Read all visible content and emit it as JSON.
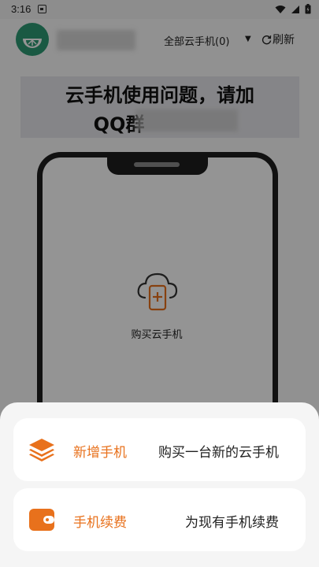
{
  "status_bar": {
    "time": "3:16"
  },
  "header": {
    "device_select": "全部云手机(0)",
    "refresh_label": "刷新"
  },
  "notice": {
    "line1": "云手机使用问题，请加",
    "line2": "QQ群"
  },
  "main": {
    "buy_label": "购买云手机"
  },
  "sheet": {
    "options": [
      {
        "title": "新增手机",
        "desc": "购买一台新的云手机",
        "icon": "layers-icon"
      },
      {
        "title": "手机续费",
        "desc": "为现有手机续费",
        "icon": "wallet-icon"
      }
    ]
  },
  "colors": {
    "accent": "#e8711c",
    "logo": "#2e9a74",
    "overlay": "rgba(0,0,0,0.42)"
  }
}
